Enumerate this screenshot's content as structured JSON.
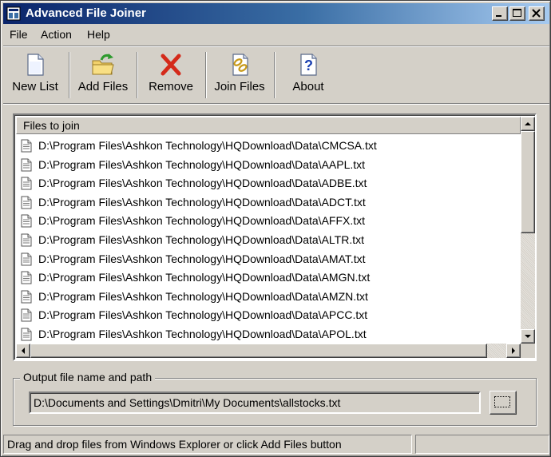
{
  "window": {
    "title": "Advanced File Joiner",
    "title_bar_color": "#0a246a"
  },
  "menu": {
    "items": [
      "File",
      "Action",
      "Help"
    ]
  },
  "toolbar": {
    "buttons": [
      {
        "label": "New List",
        "icon": "new-document-icon"
      },
      {
        "label": "Add Files",
        "icon": "add-folder-icon"
      },
      {
        "label": "Remove",
        "icon": "remove-x-icon"
      },
      {
        "label": "Join Files",
        "icon": "join-files-icon"
      },
      {
        "label": "About",
        "icon": "help-question-icon"
      }
    ]
  },
  "file_list": {
    "column_header": "Files to join",
    "files": [
      "D:\\Program Files\\Ashkon Technology\\HQDownload\\Data\\CMCSA.txt",
      "D:\\Program Files\\Ashkon Technology\\HQDownload\\Data\\AAPL.txt",
      "D:\\Program Files\\Ashkon Technology\\HQDownload\\Data\\ADBE.txt",
      "D:\\Program Files\\Ashkon Technology\\HQDownload\\Data\\ADCT.txt",
      "D:\\Program Files\\Ashkon Technology\\HQDownload\\Data\\AFFX.txt",
      "D:\\Program Files\\Ashkon Technology\\HQDownload\\Data\\ALTR.txt",
      "D:\\Program Files\\Ashkon Technology\\HQDownload\\Data\\AMAT.txt",
      "D:\\Program Files\\Ashkon Technology\\HQDownload\\Data\\AMGN.txt",
      "D:\\Program Files\\Ashkon Technology\\HQDownload\\Data\\AMZN.txt",
      "D:\\Program Files\\Ashkon Technology\\HQDownload\\Data\\APCC.txt",
      "D:\\Program Files\\Ashkon Technology\\HQDownload\\Data\\APOL.txt"
    ]
  },
  "output": {
    "group_label": "Output file name and path",
    "path": "D:\\Documents and Settings\\Dmitri\\My Documents\\allstocks.txt"
  },
  "status_bar": {
    "message": "Drag and drop files from Windows Explorer or click Add Files button"
  }
}
